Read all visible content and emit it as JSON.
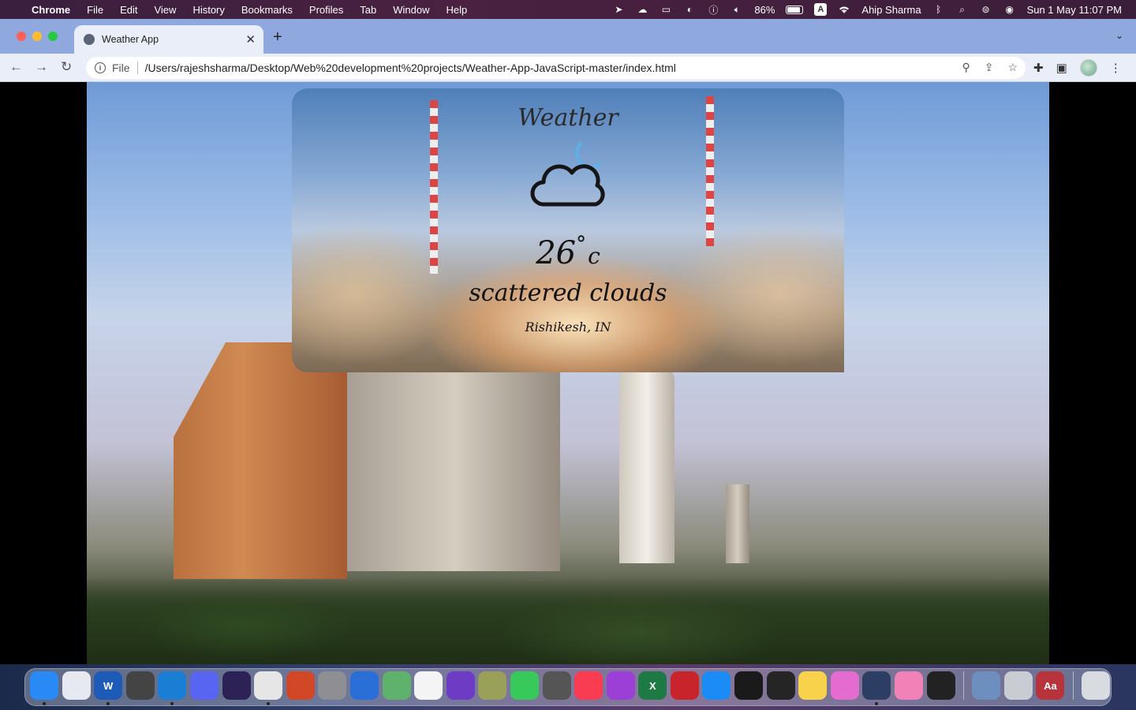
{
  "menubar": {
    "app": "Chrome",
    "items": [
      "File",
      "Edit",
      "View",
      "History",
      "Bookmarks",
      "Profiles",
      "Tab",
      "Window",
      "Help"
    ],
    "battery": "86%",
    "input_source": "A",
    "user": "Ahip Sharma",
    "datetime": "Sun 1 May  11:07 PM",
    "battery_level": 0.86
  },
  "browser": {
    "tab_title": "Weather App",
    "url_scheme": "File",
    "url": "/Users/rajeshsharma/Desktop/Web%20development%20projects/Weather-App-JavaScript-master/index.html"
  },
  "weather": {
    "title": "Weather",
    "icon": "cloud-moon-icon",
    "temperature": "26",
    "degree_symbol": "°",
    "unit": "c",
    "description": "scattered clouds",
    "location": "Rishikesh, IN"
  },
  "dock": {
    "apps": [
      {
        "name": "finder-icon",
        "color": "#2a8af5",
        "label": "",
        "running": true
      },
      {
        "name": "launchpad-icon",
        "color": "#e6e9f0",
        "label": "",
        "running": false
      },
      {
        "name": "word-icon",
        "color": "#1e5bb8",
        "label": "W",
        "running": true
      },
      {
        "name": "disk-utility-icon",
        "color": "#444",
        "label": "",
        "running": false
      },
      {
        "name": "vscode-icon",
        "color": "#1a7fd4",
        "label": "",
        "running": true
      },
      {
        "name": "discord-icon",
        "color": "#5865f2",
        "label": "",
        "running": false
      },
      {
        "name": "eclipse-icon",
        "color": "#2c2255",
        "label": "",
        "running": false
      },
      {
        "name": "chrome-icon",
        "color": "#e6e6e6",
        "label": "",
        "running": true
      },
      {
        "name": "powerpoint-icon",
        "color": "#d24726",
        "label": "",
        "running": false
      },
      {
        "name": "system-preferences-icon",
        "color": "#8e8e93",
        "label": "",
        "running": false
      },
      {
        "name": "bluetooth-icon",
        "color": "#2a6fd8",
        "label": "",
        "running": false
      },
      {
        "name": "maps-icon",
        "color": "#5fb26b",
        "label": "",
        "running": false
      },
      {
        "name": "photos-icon",
        "color": "#f4f4f4",
        "label": "",
        "running": false
      },
      {
        "name": "imovie-icon",
        "color": "#6d3bc4",
        "label": "",
        "running": false
      },
      {
        "name": "preview-icon",
        "color": "#9aa05a",
        "label": "",
        "running": false
      },
      {
        "name": "facetime-icon",
        "color": "#37c95a",
        "label": "",
        "running": false
      },
      {
        "name": "calculator-icon",
        "color": "#555",
        "label": "",
        "running": false
      },
      {
        "name": "music-icon",
        "color": "#fa3c52",
        "label": "",
        "running": false
      },
      {
        "name": "podcasts-icon",
        "color": "#9b3fd6",
        "label": "",
        "running": false
      },
      {
        "name": "excel-icon",
        "color": "#1d7a45",
        "label": "X",
        "running": false
      },
      {
        "name": "photo-booth-icon",
        "color": "#c8242b",
        "label": "",
        "running": false
      },
      {
        "name": "app-store-icon",
        "color": "#1b8cf5",
        "label": "",
        "running": false
      },
      {
        "name": "terminal-icon",
        "color": "#1a1a1a",
        "label": "",
        "running": false
      },
      {
        "name": "activity-monitor-icon",
        "color": "#252525",
        "label": "",
        "running": false
      },
      {
        "name": "notes-icon",
        "color": "#f7d24a",
        "label": "",
        "running": false
      },
      {
        "name": "color-picker-icon",
        "color": "#e46bd0",
        "label": "",
        "running": false
      },
      {
        "name": "quicktime-icon",
        "color": "#2c3e63",
        "label": "",
        "running": true
      },
      {
        "name": "screen-sharing-icon",
        "color": "#f082b8",
        "label": "",
        "running": false
      },
      {
        "name": "console-icon",
        "color": "#222",
        "label": "",
        "running": false
      }
    ],
    "recent": [
      {
        "name": "screenshot-icon",
        "color": "#6d8fbf",
        "label": ""
      },
      {
        "name": "printer-icon",
        "color": "#c9ccd3",
        "label": ""
      },
      {
        "name": "dictionary-icon",
        "color": "#b8333b",
        "label": "Aa"
      }
    ],
    "trash": {
      "name": "trash-icon",
      "color": "#d8dbe0",
      "label": ""
    }
  }
}
